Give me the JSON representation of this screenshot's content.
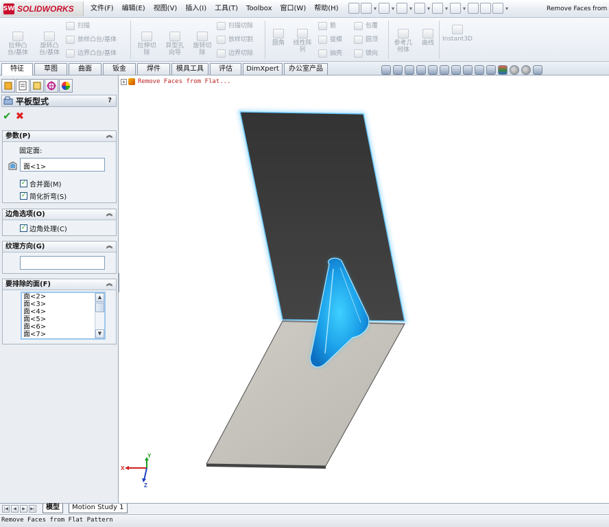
{
  "app": {
    "logo_text": "SOLIDWORKS",
    "logo_mark": "SW",
    "document_title": "Remove Faces from"
  },
  "menu": [
    "文件(F)",
    "编辑(E)",
    "视图(V)",
    "插入(I)",
    "工具(T)",
    "Toolbox",
    "窗口(W)",
    "帮助(H)"
  ],
  "ribbon": {
    "extrude_boss": "拉伸凸\n台/基体",
    "revolve_boss": "旋转凸\n台/基体",
    "sweep": "扫描",
    "loft": "放样凸台/基体",
    "boundary_boss": "边界凸台/基体",
    "extrude_cut": "拉伸切\n除",
    "hole_wizard": "异型孔\n向导",
    "revolve_cut": "旋转切\n除",
    "swept_cut": "扫描切除",
    "lofted_cut": "放样切割",
    "boundary_cut": "边界切除",
    "fillet": "圆角",
    "linear_pattern": "线性阵\n列",
    "rib": "筋",
    "draft": "拔模",
    "shell": "抽壳",
    "wrap": "包覆",
    "dome": "圆顶",
    "mirror": "镜向",
    "ref_geometry": "参考几\n何体",
    "curves": "曲线",
    "instant3d": "Instant3D"
  },
  "tabs": [
    "特征",
    "草图",
    "曲面",
    "钣金",
    "焊件",
    "模具工具",
    "评估",
    "DimXpert",
    "办公室产品"
  ],
  "property_manager": {
    "title": "平板型式",
    "help": "?",
    "ok_symbol": "✔",
    "cancel_symbol": "✖",
    "parameters": {
      "title": "参数(P)",
      "fixed_face_label": "固定面:",
      "fixed_face_value": "面<1>",
      "merge_faces": "合并面(M)",
      "simplify_bends": "简化折弯(S)"
    },
    "corner_options": {
      "title": "边角选项(O)",
      "corner_treatment": "边角处理(C)"
    },
    "grain_direction": {
      "title": "纹理方向(G)",
      "value": ""
    },
    "faces_to_exclude": {
      "title": "要排除的面(F)",
      "items": [
        "面<2>",
        "面<3>",
        "面<4>",
        "面<5>",
        "面<6>",
        "面<7>"
      ]
    }
  },
  "tree": {
    "node_label": "Remove Faces from Flat..."
  },
  "triad": {
    "x": "X",
    "y": "Y",
    "z": "Z"
  },
  "bottom_tabs": [
    "模型",
    "Motion Study 1"
  ],
  "status": "Remove Faces from Flat Pattern",
  "colors": {
    "accent_brand": "#c8102e",
    "highlight_blue": "#2aa8ff",
    "part_dark": "#3b3b3b",
    "part_light": "#c9c7c0"
  }
}
